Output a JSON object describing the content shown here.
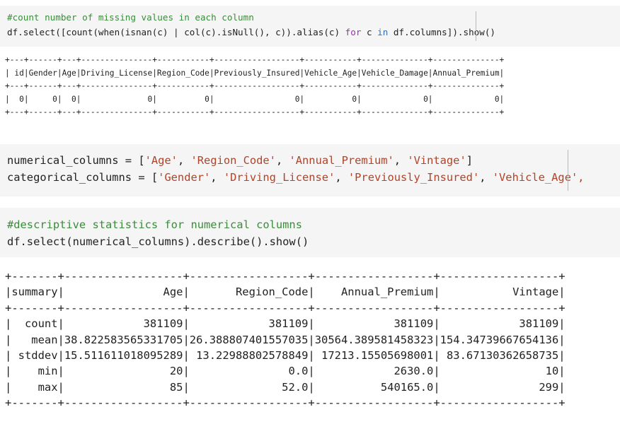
{
  "cell1": {
    "comment": "#count number of missing values in each column",
    "code_parts": {
      "p1": "df.select([count(when(isnan(c) | col(c).isNull(), c)).alias(c) ",
      "kw_for": "for",
      "p2": " c ",
      "kw_in": "in",
      "p3": " df.columns]).show()"
    }
  },
  "output1": {
    "lines": [
      "+---+------+---+---------------+-----------+------------------+-----------+--------------+--------------+",
      "| id|Gender|Age|Driving_License|Region_Code|Previously_Insured|Vehicle_Age|Vehicle_Damage|Annual_Premium|",
      "+---+------+---+---------------+-----------+------------------+-----------+--------------+--------------+",
      "|  0|     0|  0|              0|          0|                 0|          0|             0|             0|",
      "+---+------+---+---------------+-----------+------------------+-----------+--------------+--------------+"
    ]
  },
  "cell2": {
    "l1_var": "numerical_columns = [",
    "l1_items": [
      "'Age'",
      "'Region_Code'",
      "'Annual_Premium'",
      "'Vintage'"
    ],
    "l1_end": "]",
    "l2_var": "categorical_columns = [",
    "l2_items": [
      "'Gender'",
      "'Driving_License'",
      "'Previously_Insured'",
      "'Vehicle_Age',"
    ],
    "sep": ", "
  },
  "cell3": {
    "comment": "#descriptive statistics for numerical columns",
    "code": "df.select(numerical_columns).describe().show()"
  },
  "output2": {
    "lines": [
      "+-------+------------------+------------------+------------------+------------------+",
      "|summary|               Age|       Region_Code|    Annual_Premium|           Vintage|",
      "+-------+------------------+------------------+------------------+------------------+",
      "|  count|            381109|            381109|            381109|            381109|",
      "|   mean|38.822583565331705|26.388807401557035|30564.389581458323|154.34739667654136|",
      "| stddev|15.511611018095289| 13.22988802578849| 17213.15505698001| 83.67130362658735|",
      "|    min|                20|               0.0|            2630.0|                10|",
      "|    max|                85|              52.0|          540165.0|               299|",
      "+-------+------------------+------------------+------------------+------------------+"
    ]
  }
}
